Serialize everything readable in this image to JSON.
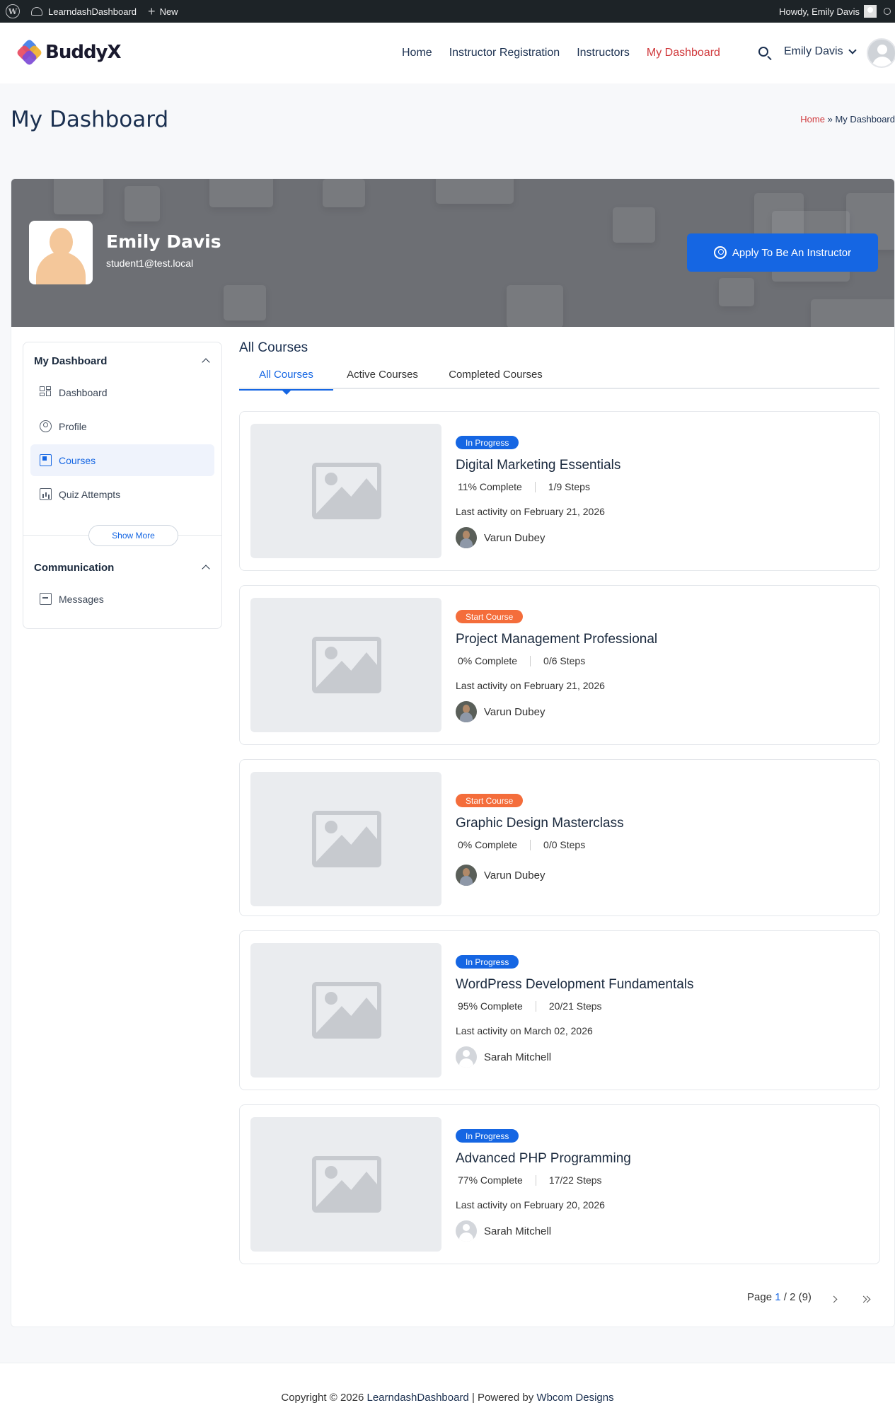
{
  "adminbar": {
    "site_name": "LearndashDashboard",
    "new_label": "New",
    "howdy": "Howdy, Emily Davis"
  },
  "header": {
    "brand": "BuddyX",
    "nav": [
      {
        "label": "Home",
        "active": false
      },
      {
        "label": "Instructor Registration",
        "active": false
      },
      {
        "label": "Instructors",
        "active": false
      },
      {
        "label": "My Dashboard",
        "active": true
      }
    ],
    "user_name": "Emily Davis"
  },
  "page": {
    "title": "My Dashboard",
    "breadcrumb_home": "Home",
    "breadcrumb_sep": "»",
    "breadcrumb_current": "My Dashboard"
  },
  "profile": {
    "name": "Emily Davis",
    "email": "student1@test.local",
    "apply_label": "Apply To Be An Instructor"
  },
  "sidebar": {
    "group1_title": "My Dashboard",
    "items": [
      {
        "label": "Dashboard",
        "icon": "dashboard-icon"
      },
      {
        "label": "Profile",
        "icon": "profile-icon"
      },
      {
        "label": "Courses",
        "icon": "courses-icon"
      },
      {
        "label": "Quiz Attempts",
        "icon": "quiz-icon"
      }
    ],
    "show_more": "Show More",
    "group2_title": "Communication",
    "group2_items": [
      {
        "label": "Messages",
        "icon": "messages-icon"
      }
    ]
  },
  "courses": {
    "section_title": "All Courses",
    "tabs": [
      "All Courses",
      "Active Courses",
      "Completed Courses"
    ],
    "items": [
      {
        "status": "In Progress",
        "title": "Digital Marketing Essentials",
        "complete": "11% Complete",
        "steps": "1/9 Steps",
        "activity": "Last activity on February 21, 2026",
        "author": "Varun Dubey"
      },
      {
        "status": "Start Course",
        "title": "Project Management Professional",
        "complete": "0% Complete",
        "steps": "0/6 Steps",
        "activity": "Last activity on February 21, 2026",
        "author": "Varun Dubey"
      },
      {
        "status": "Start Course",
        "title": "Graphic Design Masterclass",
        "complete": "0% Complete",
        "steps": "0/0 Steps",
        "author": "Varun Dubey"
      },
      {
        "status": "In Progress",
        "title": "WordPress Development Fundamentals",
        "complete": "95% Complete",
        "steps": "20/21 Steps",
        "activity": "Last activity on March 02, 2026",
        "author": "Sarah Mitchell"
      },
      {
        "status": "In Progress",
        "title": "Advanced PHP Programming",
        "complete": "77% Complete",
        "steps": "17/22 Steps",
        "activity": "Last activity on February 20, 2026",
        "author": "Sarah Mitchell"
      }
    ],
    "pager_prefix": "Page",
    "pager_current": "1",
    "pager_rest": "/ 2 (9)"
  },
  "footer": {
    "copyright": "Copyright © 2026",
    "site_link": "LearndashDashboard",
    "powered_by": "| Powered by",
    "company": "Wbcom Designs"
  }
}
